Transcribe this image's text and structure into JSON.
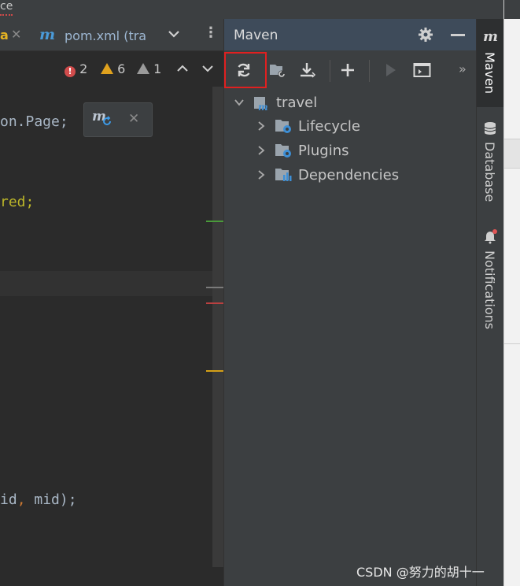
{
  "top_strip": {
    "text": "ce"
  },
  "editor": {
    "tabs": {
      "fragment": "a",
      "m_glyph": "m",
      "name": "pom.xml (tra"
    },
    "inspections": {
      "errors": "2",
      "warnings": "6",
      "weak_warnings": "1"
    },
    "code": {
      "line1": "on.Page;",
      "line2": "red;",
      "line3_a": "id",
      "line3_b": ", ",
      "line3_c": "mid);"
    },
    "popup": {
      "icon": "maven-reload-icon",
      "m_glyph": "m"
    }
  },
  "maven": {
    "title": "Maven",
    "more": "»",
    "tree": {
      "root": "travel",
      "children": [
        {
          "label": "Lifecycle"
        },
        {
          "label": "Plugins"
        },
        {
          "label": "Dependencies"
        }
      ]
    }
  },
  "right_stripe": {
    "m_glyph": "m",
    "items": [
      {
        "label": "Maven",
        "icon": "maven-icon"
      },
      {
        "label": "Database",
        "icon": "database-icon"
      },
      {
        "label": "Notifications",
        "icon": "bell-icon"
      }
    ]
  },
  "watermark": "CSDN @努力的胡十一",
  "colors": {
    "highlight_box": "#e02020",
    "maven_header": "#3e4b5a",
    "error": "#d14c4c",
    "warning": "#e0a21e"
  }
}
